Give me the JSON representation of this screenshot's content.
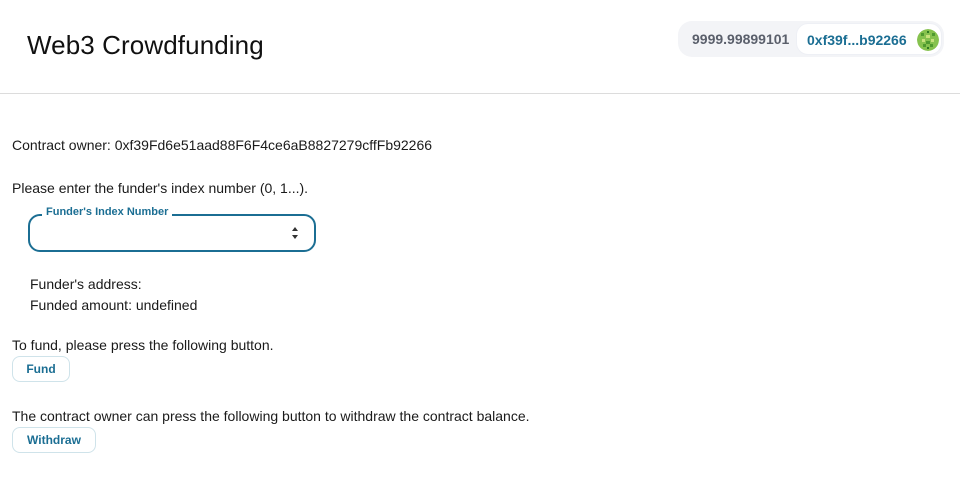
{
  "header": {
    "title": "Web3 Crowdfunding",
    "wallet": {
      "balance": "9999.99899101",
      "address": "0xf39f...b92266"
    }
  },
  "main": {
    "owner_label": "Contract owner: 0xf39Fd6e51aad88F6F4ce6aB8827279cffFb92266",
    "index_prompt": "Please enter the funder's index number (0, 1...).",
    "index_field": {
      "label": "Funder's Index Number",
      "value": ""
    },
    "funder_address": "Funder's address:",
    "funded_amount": "Funded amount: undefined",
    "fund_prompt": "To fund, please press the following button.",
    "fund_button": "Fund",
    "withdraw_prompt": "The contract owner can press the following button to withdraw the contract balance.",
    "withdraw_button": "Withdraw"
  },
  "colors": {
    "accent": "#1b6e93",
    "avatar": "#7cc04a"
  }
}
